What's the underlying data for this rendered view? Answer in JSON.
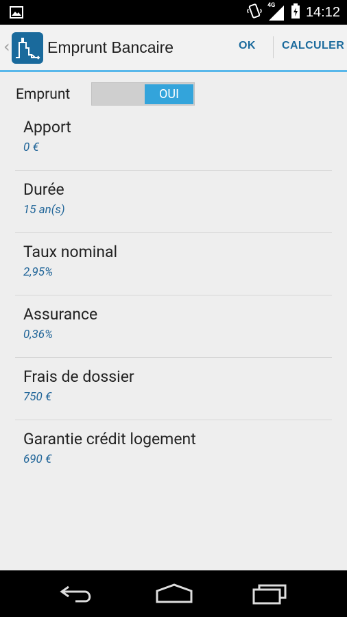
{
  "status": {
    "time": "14:12",
    "network": "4G"
  },
  "actionbar": {
    "title": "Emprunt Bancaire",
    "ok": "OK",
    "calculer": "CALCULER"
  },
  "toggle": {
    "label": "Emprunt",
    "value": "OUI"
  },
  "items": [
    {
      "title": "Apport",
      "value": "0 €"
    },
    {
      "title": "Durée",
      "value": "15 an(s)"
    },
    {
      "title": "Taux nominal",
      "value": "2,95%"
    },
    {
      "title": "Assurance",
      "value": "0,36%"
    },
    {
      "title": "Frais de dossier",
      "value": "750 €"
    },
    {
      "title": "Garantie crédit logement",
      "value": "690 €"
    }
  ],
  "colors": {
    "accent": "#33a4db",
    "brand": "#1a6a9c",
    "value_text": "#226699"
  }
}
